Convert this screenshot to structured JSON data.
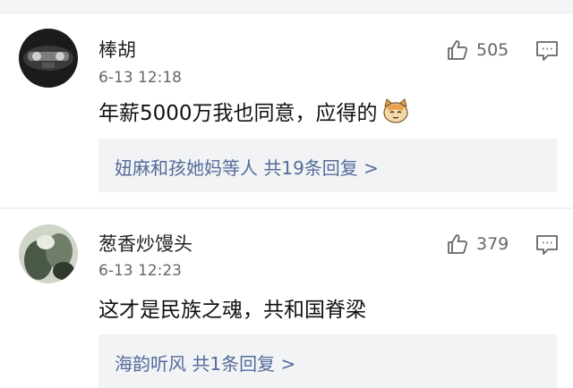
{
  "comments": [
    {
      "username": "棒胡",
      "time": "6-13 12:18",
      "likes": "505",
      "content": "年薪5000万我也同意，应得的",
      "emoji": "cat-emoji",
      "replies_summary": "妞麻和孩她妈等人  共19条回复 >"
    },
    {
      "username": "葱香炒馒头",
      "time": "6-13 12:23",
      "likes": "379",
      "content": "这才是民族之魂，共和国脊梁",
      "replies_summary": "海韵听风  共1条回复 >"
    }
  ],
  "colors": {
    "link": "#556c99",
    "reply_bg": "#f2f3f5"
  }
}
